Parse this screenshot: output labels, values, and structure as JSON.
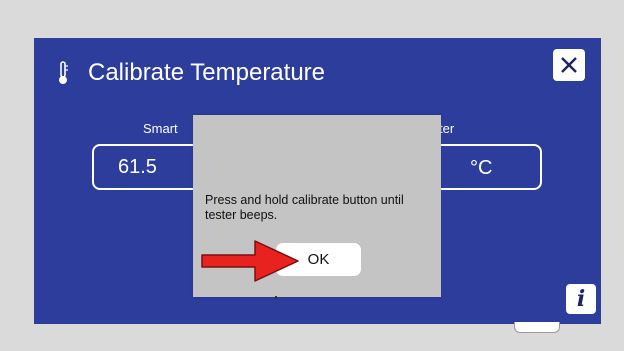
{
  "header": {
    "title": "Calibrate Temperature"
  },
  "labels": {
    "left": "Smart",
    "right": "ter"
  },
  "fields": {
    "left_value": "61.5",
    "right_unit": "°C"
  },
  "dialog": {
    "message": "Press and hold calibrate button until tester beeps.",
    "ok_label": "OK"
  },
  "icons": {
    "thermometer": "thermometer-icon",
    "close": "close-icon",
    "info": "info-icon",
    "arrow": "red-arrow-icon"
  },
  "colors": {
    "screen": "#2d3d9b",
    "dialog": "#c4c4c4",
    "arrow": "#e8231f"
  }
}
